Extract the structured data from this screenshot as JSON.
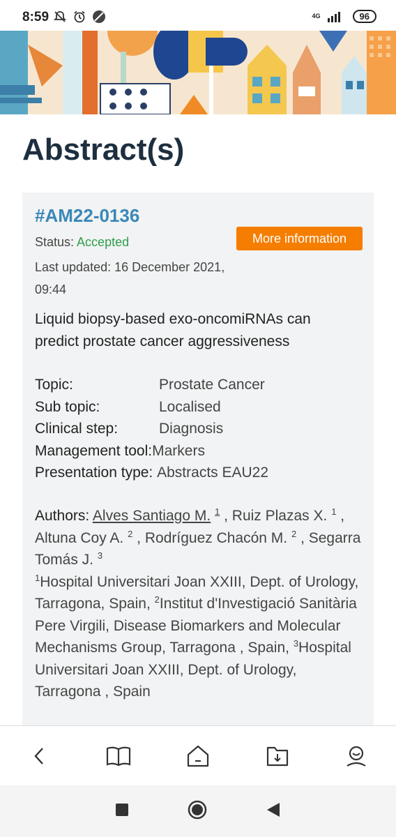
{
  "status_bar": {
    "time": "8:59",
    "network": "4G",
    "battery": "96"
  },
  "page": {
    "title": "Abstract(s)"
  },
  "abstract": {
    "id": "#AM22-0136",
    "more_info_label": "More information",
    "status_label": "Status: ",
    "status_value": "Accepted",
    "last_updated": "Last updated: 16 December 2021, 09:44",
    "title": "Liquid biopsy-based exo-oncomiRNAs can predict prostate cancer aggressiveness",
    "meta": [
      {
        "label": "Topic:",
        "value": "Prostate Cancer"
      },
      {
        "label": "Sub topic:",
        "value": "Localised"
      },
      {
        "label": "Clinical step:",
        "value": "Diagnosis"
      },
      {
        "label": "Management tool:",
        "value": "Markers"
      },
      {
        "label": "Presentation type:",
        "value": "Abstracts EAU22"
      }
    ],
    "authors_label": "Authors:",
    "authors": [
      {
        "name": "Alves Santiago M.",
        "sup": "1"
      },
      {
        "name": "Ruiz Plazas X.",
        "sup": "1"
      },
      {
        "name": "Altuna Coy A.",
        "sup": "2"
      },
      {
        "name": "Rodríguez Chacón M.",
        "sup": "2"
      },
      {
        "name": "Segarra Tomás J.",
        "sup": "3"
      }
    ],
    "affiliations": [
      {
        "sup": "1",
        "text": "Hospital Universitari Joan XXIII, Dept. of Urology, Tarragona, Spain,"
      },
      {
        "sup": "2",
        "text": "Institut d'Investigació Sanitària Pere Virgili, Disease Biomarkers and Molecular Mechanisms Group, Tarragona , Spain,"
      },
      {
        "sup": "3",
        "text": "Hospital Universitari Joan XXIII, Dept. of Urology, Tarragona , Spain"
      }
    ]
  },
  "bottom_nav": [
    "back-icon",
    "book-icon",
    "home-icon",
    "download-icon",
    "profile-icon"
  ],
  "colors": {
    "accent_orange": "#f57d00",
    "id_blue": "#3a88b8",
    "accepted_green": "#2e9e4b",
    "title_navy": "#1d2f3f"
  }
}
